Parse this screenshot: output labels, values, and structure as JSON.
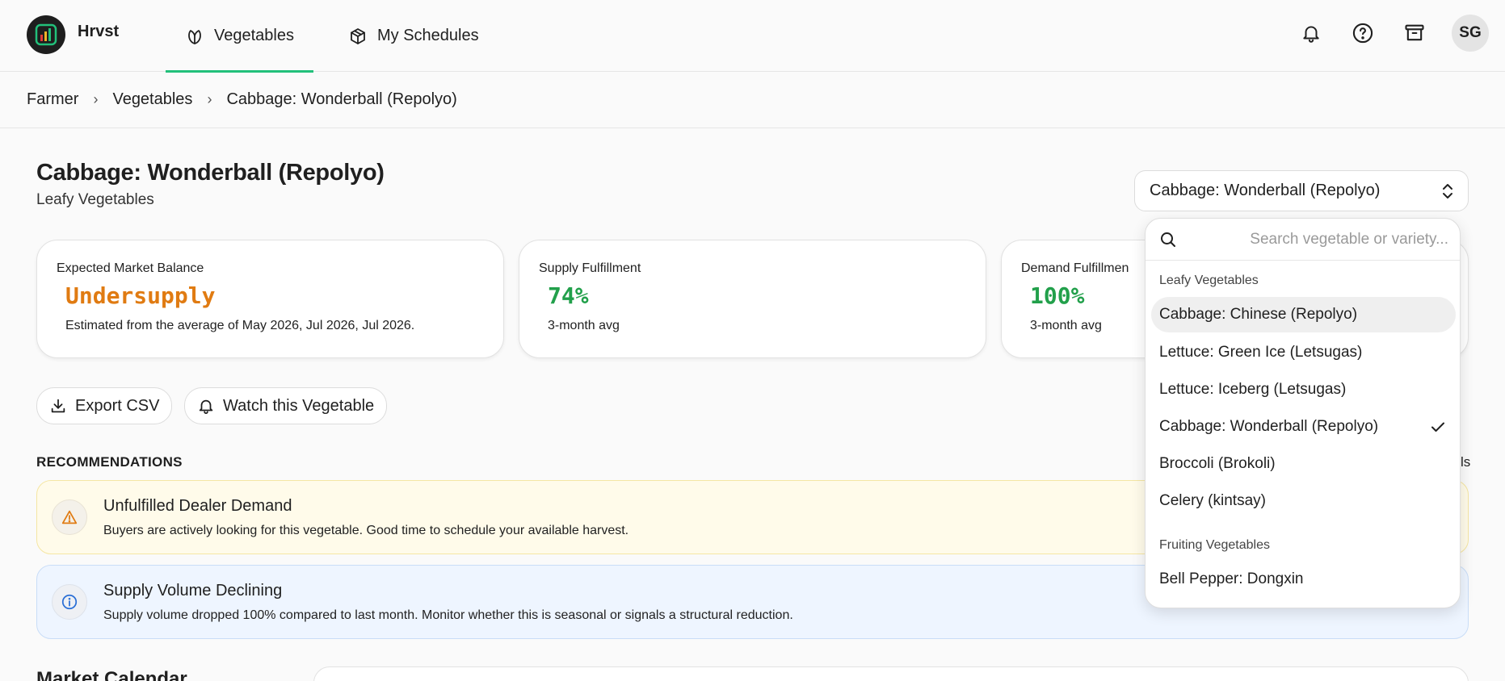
{
  "app": {
    "brand": "Hrvst"
  },
  "nav": {
    "tabs": [
      {
        "label": "Vegetables",
        "active": true
      },
      {
        "label": "My Schedules",
        "active": false
      }
    ],
    "avatar_initials": "SG"
  },
  "breadcrumb": [
    "Farmer",
    "Vegetables",
    "Cabbage: Wonderball (Repolyo)"
  ],
  "header": {
    "title": "Cabbage: Wonderball (Repolyo)",
    "subtitle": "Leafy Vegetables",
    "selector_value": "Cabbage: Wonderball (Repolyo)"
  },
  "cards": [
    {
      "label": "Expected Market Balance",
      "value": "Undersupply",
      "note": "Estimated from the average of May 2026, Jul 2026, Jul 2026.",
      "color": "#e07b12"
    },
    {
      "label": "Supply Fulfillment",
      "value": "74%",
      "note": "3-month avg",
      "color": "#22a04b"
    },
    {
      "label": "Demand Fulfillmen",
      "value": "100%",
      "note": "3-month avg",
      "color": "#22a04b"
    }
  ],
  "actions": {
    "export": "Export CSV",
    "watch": "Watch this Vegetable"
  },
  "recommendations": {
    "heading": "RECOMMENDATIONS",
    "right_fragment": "ls",
    "items": [
      {
        "title": "Unfulfilled Dealer Demand",
        "desc": "Buyers are actively looking for this vegetable. Good time to schedule your available harvest.",
        "kind": "warning"
      },
      {
        "title": "Supply Volume Declining",
        "desc": "Supply volume dropped 100% compared to last month. Monitor whether this is seasonal or signals a structural reduction.",
        "kind": "info"
      }
    ]
  },
  "market_calendar": {
    "heading": "Market Calendar"
  },
  "dropdown": {
    "search_placeholder": "Search vegetable or variety...",
    "groups": [
      {
        "label": "Leafy Vegetables",
        "items": [
          {
            "label": "Cabbage: Chinese (Repolyo)",
            "highlighted": true,
            "selected": false
          },
          {
            "label": "Lettuce: Green Ice (Letsugas)",
            "highlighted": false,
            "selected": false
          },
          {
            "label": "Lettuce: Iceberg (Letsugas)",
            "highlighted": false,
            "selected": false
          },
          {
            "label": "Cabbage: Wonderball (Repolyo)",
            "highlighted": false,
            "selected": true
          },
          {
            "label": "Broccoli (Brokoli)",
            "highlighted": false,
            "selected": false
          },
          {
            "label": "Celery (kintsay)",
            "highlighted": false,
            "selected": false
          }
        ]
      },
      {
        "label": "Fruiting Vegetables",
        "items": [
          {
            "label": "Bell Pepper: Dongxin",
            "highlighted": false,
            "selected": false
          }
        ]
      }
    ]
  },
  "colors": {
    "accent": "#22c07a",
    "warning_bg": "#fffbea",
    "warning_border": "#f5e6a3",
    "info_bg": "#eef5ff",
    "info_border": "#c9ddf7"
  }
}
